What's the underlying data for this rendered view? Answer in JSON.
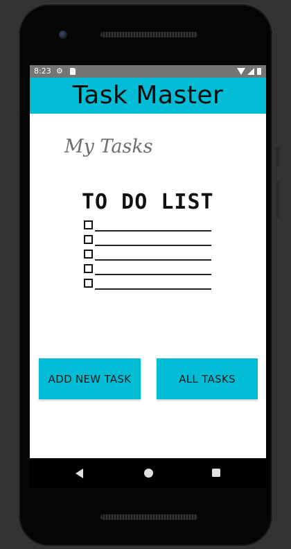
{
  "status_bar": {
    "time": "8:23",
    "icons": [
      "gear-icon",
      "sd-card-icon",
      "wifi-icon",
      "signal-icon",
      "battery-icon"
    ]
  },
  "app_bar": {
    "title": "Task Master",
    "color": "#00bcd4"
  },
  "main": {
    "heading": "My Tasks",
    "image": {
      "title": "TO DO LIST",
      "checkbox_rows": 5
    },
    "buttons": {
      "add_new_task": "ADD NEW TASK",
      "all_tasks": "ALL TASKS"
    }
  },
  "nav_bar": {
    "icons": [
      "back-icon",
      "home-icon",
      "recents-icon"
    ]
  }
}
